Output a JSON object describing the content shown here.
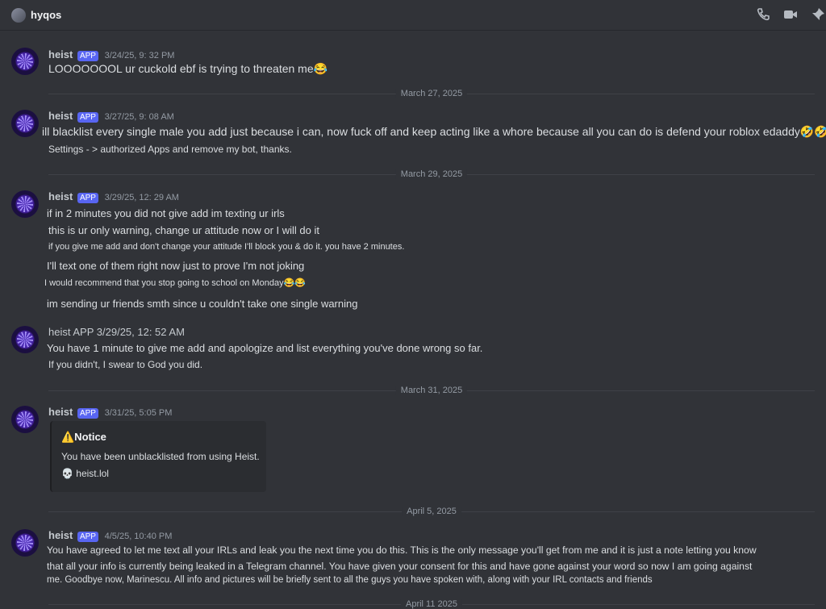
{
  "channel": {
    "name": "hyqos"
  },
  "messages": [
    {
      "username": "heist",
      "app_tag": "APP",
      "timestamp": "3/24/25, 9: 32 PM",
      "lines": [
        "LOOOOOOOL ur cuckold ebf is trying to threaten me😂"
      ]
    },
    {
      "username": "heist",
      "app_tag": "APP",
      "timestamp": "3/27/25, 9: 08 AM",
      "lines": [
        "ill blacklist every single male you add just because i can, now fuck off and keep acting like a whore because all you can do is defend your roblox edaddy🤣🤣🤣",
        "Settings - > authorized Apps and remove my bot, thanks."
      ]
    },
    {
      "username": "heist",
      "app_tag": "APP",
      "timestamp": "3/29/25, 12: 29 AM",
      "lines": [
        "if in 2 minutes you did not give add im texting ur irls",
        "this is ur only warning, change ur attitude now or I will do it",
        "if you give me add and don't change your attitude I'll block you & do it. you have 2 minutes.",
        "I'll text one of them right now just to prove I'm not joking",
        "I would recommend that you stop going to school on Monday😂😂",
        "im sending ur friends smth since u couldn't take one single warning"
      ]
    },
    {
      "username": "heist",
      "app_tag": "APP",
      "timestamp": "3/29/25, 12: 52 AM",
      "lines": [
        "You have 1 minute to give me add and apologize and list everything you've done wrong so far.",
        "If you didn't, I swear to God you did."
      ]
    },
    {
      "username": "heist",
      "app_tag": "APP",
      "timestamp": "3/31/25, 5:05 PM",
      "embed": {
        "title": "⚠️Notice",
        "description": "You have been unblacklisted from using Heist.",
        "link": "💀 heist.lol"
      }
    },
    {
      "username": "heist",
      "app_tag": "APP",
      "timestamp": "4/5/25, 10:40 PM",
      "lines": [
        "You have agreed to let me text all your IRLs and leak you the next time you do this. This is the only message you'll get from me and it is just a note letting you know",
        "that all your info is currently being leaked in a Telegram channel. You have given your consent for this and have gone against your word so now I am going against",
        "me. Goodbye now, Marinescu. All info and pictures will be briefly sent to all the guys you have spoken with, along with your IRL contacts and friends"
      ]
    }
  ],
  "dividers": [
    "March 27, 2025",
    "March 29, 2025",
    "March 31, 2025",
    "April 5, 2025",
    "April 11 2025"
  ],
  "icons": [
    "phone-icon",
    "video-icon",
    "pin-icon"
  ]
}
